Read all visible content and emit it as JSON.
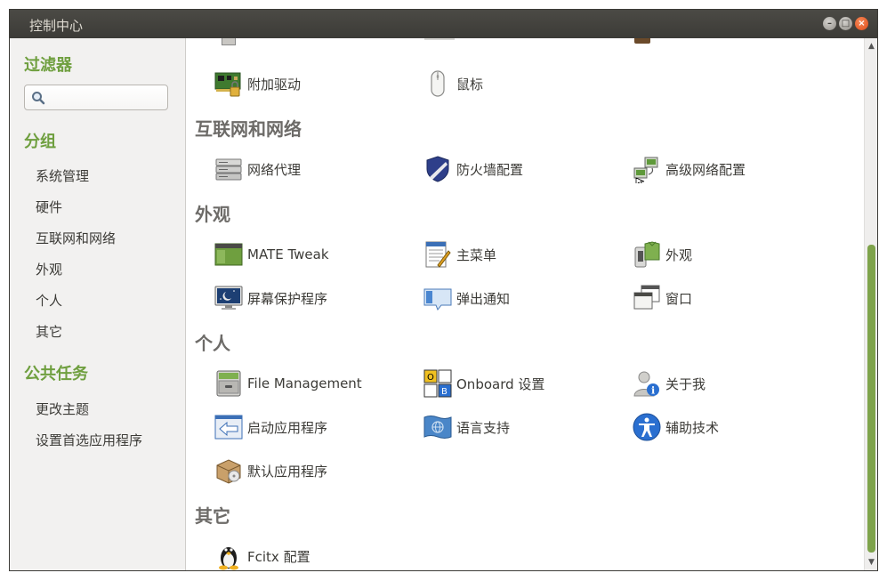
{
  "window": {
    "title": "控制中心"
  },
  "sidebar": {
    "filter_heading": "过滤器",
    "search_placeholder": "",
    "groups_heading": "分组",
    "groups": [
      {
        "label": "系统管理"
      },
      {
        "label": "硬件"
      },
      {
        "label": "互联网和网络"
      },
      {
        "label": "外观"
      },
      {
        "label": "个人"
      },
      {
        "label": "其它"
      }
    ],
    "tasks_heading": "公共任务",
    "tasks": [
      {
        "label": "更改主题"
      },
      {
        "label": "设置首选应用程序"
      }
    ]
  },
  "content": {
    "hardware_partial": {
      "items": [
        {
          "label": "附加驱动",
          "icon": "driver-card-icon"
        },
        {
          "label": "鼠标",
          "icon": "mouse-icon"
        }
      ]
    },
    "categories": [
      {
        "title": "互联网和网络",
        "items": [
          {
            "label": "网络代理",
            "icon": "network-proxy-icon"
          },
          {
            "label": "防火墙配置",
            "icon": "firewall-shield-icon"
          },
          {
            "label": "高级网络配置",
            "icon": "network-config-icon"
          }
        ]
      },
      {
        "title": "外观",
        "items": [
          {
            "label": "MATE Tweak",
            "icon": "mate-tweak-icon"
          },
          {
            "label": "主菜单",
            "icon": "main-menu-icon"
          },
          {
            "label": "外观",
            "icon": "appearance-icon"
          },
          {
            "label": "屏幕保护程序",
            "icon": "screensaver-icon"
          },
          {
            "label": "弹出通知",
            "icon": "notification-icon"
          },
          {
            "label": "窗口",
            "icon": "window-icon"
          }
        ]
      },
      {
        "title": "个人",
        "items": [
          {
            "label": "File Management",
            "icon": "file-cabinet-icon"
          },
          {
            "label": "Onboard 设置",
            "icon": "onboard-keyboard-icon"
          },
          {
            "label": "关于我",
            "icon": "about-me-icon"
          },
          {
            "label": "启动应用程序",
            "icon": "startup-apps-icon"
          },
          {
            "label": "语言支持",
            "icon": "language-flag-icon"
          },
          {
            "label": "辅助技术",
            "icon": "accessibility-icon"
          },
          {
            "label": "默认应用程序",
            "icon": "default-apps-icon"
          }
        ]
      },
      {
        "title": "其它",
        "items": [
          {
            "label": "Fcitx 配置",
            "icon": "penguin-icon"
          }
        ]
      }
    ]
  },
  "colors": {
    "accent_green": "#6f9f3f",
    "titlebar": "#3c3b37",
    "close_button": "#df4a16"
  }
}
